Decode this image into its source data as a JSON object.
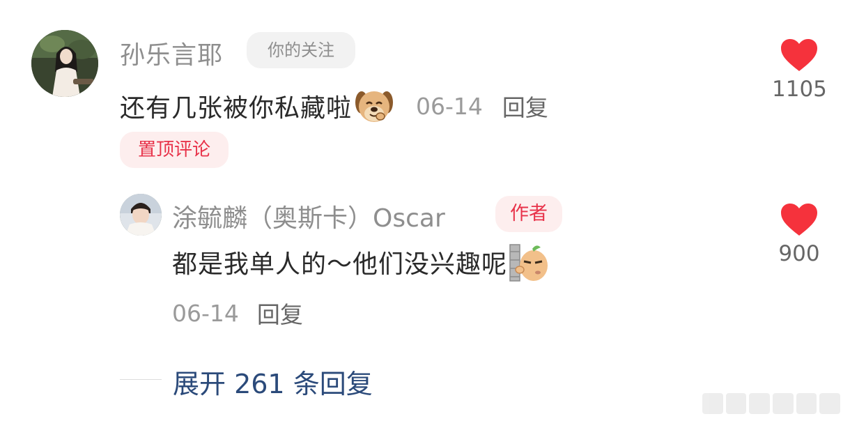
{
  "thread": {
    "top_comment": {
      "username": "孙乐言耶",
      "follow_tag": "你的关注",
      "text": "还有几张被你私藏啦",
      "emoji": "dog-emoji",
      "date": "06-14",
      "reply_label": "回复",
      "pinned_tag": "置顶评论",
      "likes": "1105"
    },
    "reply": {
      "username": "涂毓麟（奥斯卡）Oscar",
      "author_tag": "作者",
      "text": "都是我单人的～他们没兴趣呢",
      "emoji": "peeking-potato-emoji",
      "date": "06-14",
      "reply_label": "回复",
      "likes": "900"
    },
    "expand_label": "展开 261 条回复"
  },
  "colors": {
    "like_red": "#f5323c",
    "tag_red": "#e8334a",
    "expand_blue": "#2b4a7a",
    "meta_gray": "#9a9a9a"
  }
}
